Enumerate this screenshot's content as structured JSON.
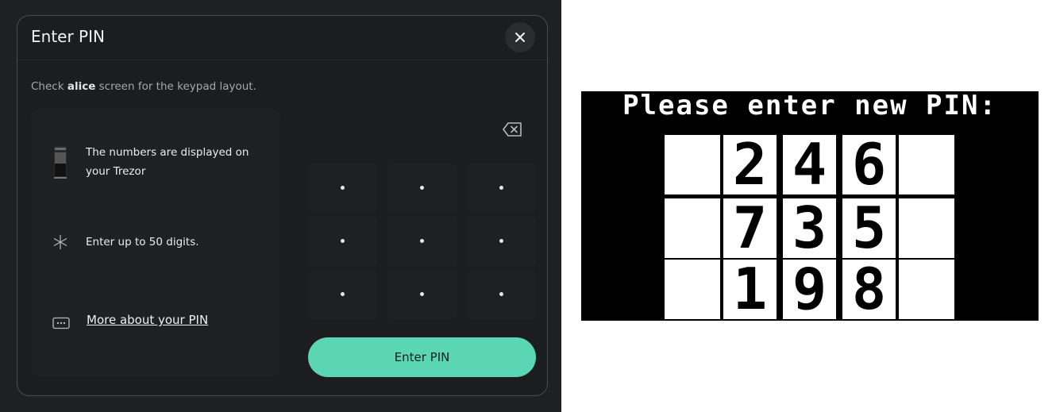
{
  "modal": {
    "title": "Enter PIN",
    "subtitle_prefix": "Check ",
    "subtitle_device": "alice",
    "subtitle_suffix": " screen for the keypad layout.",
    "info": {
      "numbers_displayed": "The numbers are displayed on your Trezor",
      "digits_limit": "Enter up to 50 digits.",
      "more_link": "More about your PIN"
    },
    "enter_button": "Enter PIN",
    "keypad_keys": 9
  },
  "device_screen": {
    "title": "Please enter new PIN:",
    "rows": [
      [
        "2",
        "4",
        "6"
      ],
      [
        "7",
        "3",
        "5"
      ],
      [
        "1",
        "9",
        "8"
      ]
    ]
  },
  "colors": {
    "accent": "#5ad6b4",
    "modal_bg": "#1c1d1e",
    "page_bg": "#1f2021"
  }
}
